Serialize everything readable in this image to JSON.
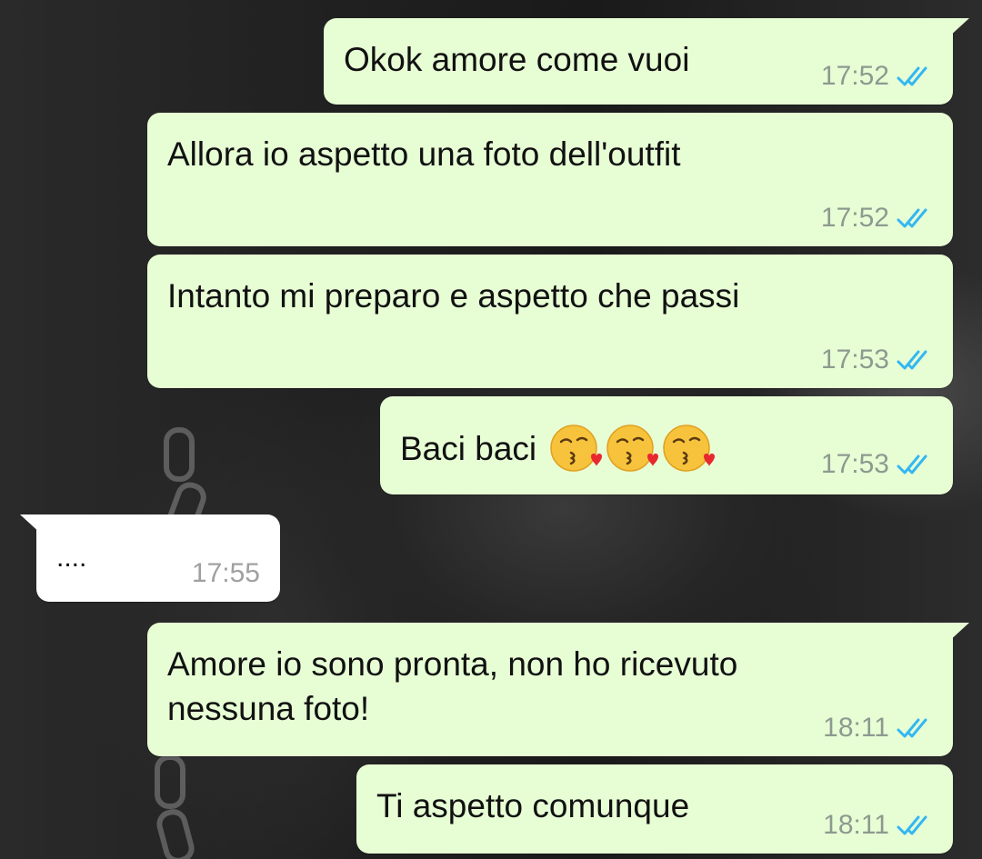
{
  "colors": {
    "outgoing_bubble": "#e7fed5",
    "incoming_bubble": "#ffffff",
    "read_ticks": "#34b7f1",
    "timestamp": "#8d9a8f"
  },
  "messages": [
    {
      "direction": "outgoing",
      "text": "Okok amore come vuoi",
      "time": "17:52",
      "status_icon": "double-check-read-icon"
    },
    {
      "direction": "outgoing",
      "text": "Allora io aspetto una foto dell'outfit",
      "time": "17:52",
      "status_icon": "double-check-read-icon"
    },
    {
      "direction": "outgoing",
      "text": "Intanto mi preparo e aspetto che passi",
      "time": "17:53",
      "status_icon": "double-check-read-icon"
    },
    {
      "direction": "outgoing",
      "text": "Baci baci",
      "emojis": [
        "kissing-face-with-heart-emoji",
        "kissing-face-with-heart-emoji",
        "kissing-face-with-heart-emoji"
      ],
      "time": "17:53",
      "status_icon": "double-check-read-icon"
    },
    {
      "direction": "incoming",
      "text": "....",
      "time": "17:55"
    },
    {
      "direction": "outgoing",
      "text_lines": [
        "Amore io sono pronta, non ho ricevuto",
        "nessuna foto!"
      ],
      "time": "18:11",
      "status_icon": "double-check-read-icon"
    },
    {
      "direction": "outgoing",
      "text": "Ti aspetto comunque",
      "time": "18:11",
      "status_icon": "double-check-read-icon"
    }
  ]
}
